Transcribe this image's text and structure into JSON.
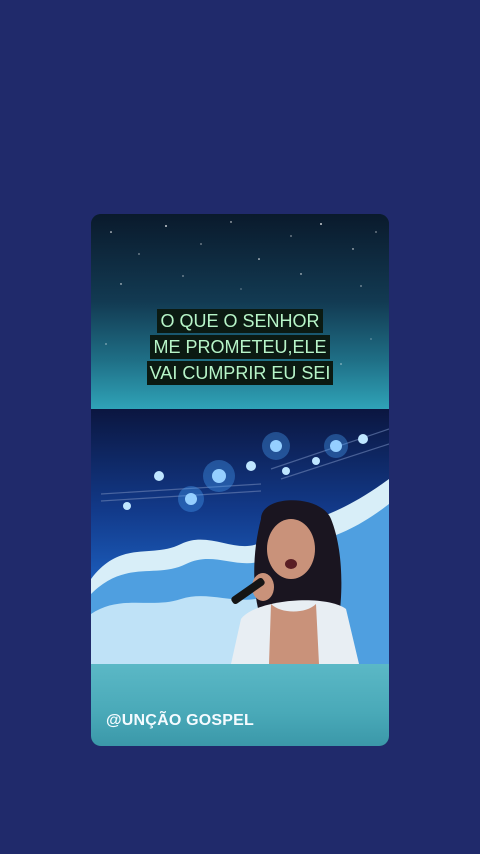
{
  "caption": {
    "line1": "O QUE O SENHOR",
    "line2": "ME PROMETEU,ELE",
    "line3": "VAI CUMPRIR EU SEI"
  },
  "watermark": {
    "handle": "@UNÇÃO GOSPEL"
  },
  "colors": {
    "background": "#202a6b",
    "caption_text": "#b7f5c8",
    "caption_bg": "#0b1a12",
    "stage_blue": "#1c5fbf",
    "water": "#49a9b8"
  }
}
